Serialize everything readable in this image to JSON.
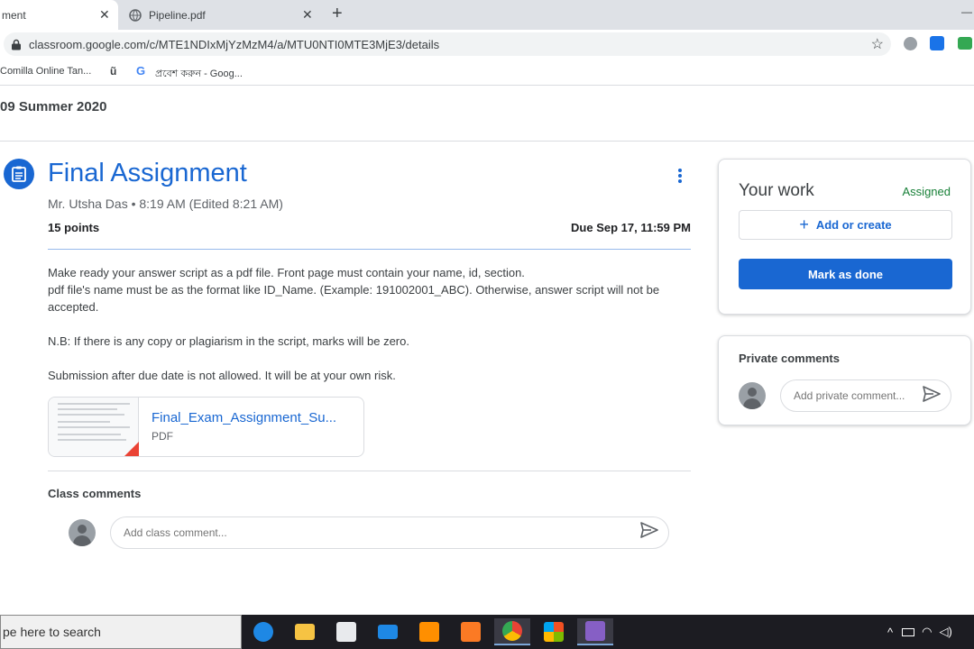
{
  "browser": {
    "tabs": [
      {
        "label": "ment",
        "close": "✕"
      },
      {
        "label": "Pipeline.pdf",
        "close": "✕"
      }
    ],
    "new_tab": "+",
    "minimize": "—",
    "url": "classroom.google.com/c/MTE1NDIxMjYzMzM4/a/MTU0NTI0MTE3MjE3/details",
    "bookmarks": [
      {
        "label": "Comilla Online Tan..."
      },
      {
        "label": "ũ"
      },
      {
        "label": "প্রবেশ করুন - Goog..."
      }
    ]
  },
  "class": {
    "name": "09 Summer 2020"
  },
  "assignment": {
    "title": "Final Assignment",
    "meta": "Mr. Utsha Das • 8:19 AM (Edited 8:21 AM)",
    "points": "15 points",
    "due": "Due Sep 17, 11:59 PM",
    "description": [
      "Make ready your answer script as a pdf file. Front page must contain your name, id, section.",
      "pdf file's name must be as the format like ID_Name. (Example: 191002001_ABC). Otherwise, answer script will not be accepted.",
      "",
      "N.B: If there is any copy or plagiarism in the script, marks will be zero.",
      "",
      "Submission after due date is not allowed. It will be at your own risk."
    ],
    "attachment": {
      "name": "Final_Exam_Assignment_Su...",
      "type": "PDF"
    },
    "class_comments_label": "Class comments",
    "class_comment_placeholder": "Add class comment..."
  },
  "your_work": {
    "title": "Your work",
    "status": "Assigned",
    "add_label": "Add or create",
    "mark_done_label": "Mark as done"
  },
  "private_comments": {
    "title": "Private comments",
    "placeholder": "Add private comment..."
  },
  "taskbar": {
    "search_text": "pe here to search"
  },
  "colors": {
    "accent": "#1967d2",
    "assigned": "#188038",
    "taskbar": "#1c1c22"
  }
}
